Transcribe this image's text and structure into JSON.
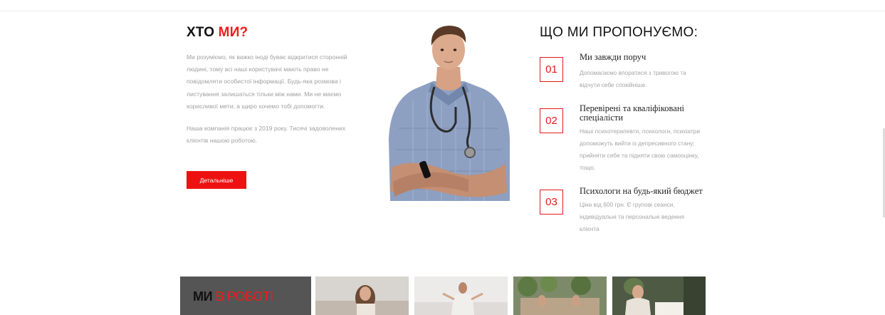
{
  "about": {
    "title_main": "ХТО",
    "title_accent": "МИ?",
    "paragraph_1": "Ми розуміємо, як важко іноді буває відкритися сторонній людині, тому всі наші користувачі мають право не повідомляти особистої інформації. Будь-яка розмова і листування залишаться тільки між нами. Ми не маємо корисливої мети, а щиро хочемо тобі допомогти.",
    "paragraph_2": "Наша компанія працює з 2019 року. Тисячі задоволених клієнтів нашою роботою.",
    "button_label": "Детальніше"
  },
  "offers": {
    "title": "ЩО МИ ПРОПОНУЄМО:",
    "items": [
      {
        "number": "01",
        "title": "Ми завжди поруч",
        "description": "Допомагаємо впоратися з тривогою та відчути себе спокійніше."
      },
      {
        "number": "02",
        "title": "Перевірені та кваліфіковані спеціалісти",
        "description": "Наші психотерапевти, психологи, психіатри допоможуть вийти із депресивного стану; прийняти себе та підняти свою самооцінку, тощо."
      },
      {
        "number": "03",
        "title": "Психологи на будь-який бюджет",
        "description": "Ціна від 600 грн. Є групові сеанси, індивідуальні та персональні ведення клієнта"
      }
    ]
  },
  "gallery": {
    "title_main": "МИ",
    "title_accent": "В РОБОТІ"
  },
  "colors": {
    "accent": "#ee1c1c",
    "muted_text": "#a0a0a0",
    "gallery_card": "#555555"
  }
}
